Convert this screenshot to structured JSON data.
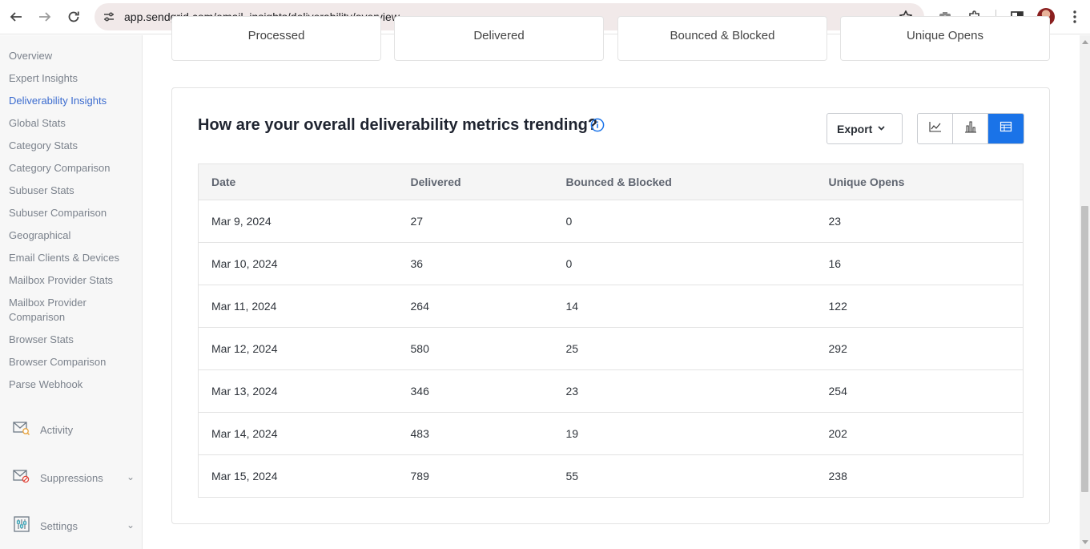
{
  "browser": {
    "url": "app.sendgrid.com/email_insights/deliverability/overview"
  },
  "sidebar": {
    "links": [
      {
        "label": "Overview",
        "active": false
      },
      {
        "label": "Expert Insights",
        "active": false
      },
      {
        "label": "Deliverability Insights",
        "active": true
      },
      {
        "label": "Global Stats",
        "active": false
      },
      {
        "label": "Category Stats",
        "active": false
      },
      {
        "label": "Category Comparison",
        "active": false
      },
      {
        "label": "Subuser Stats",
        "active": false
      },
      {
        "label": "Subuser Comparison",
        "active": false
      },
      {
        "label": "Geographical",
        "active": false
      },
      {
        "label": "Email Clients & Devices",
        "active": false
      },
      {
        "label": "Mailbox Provider Stats",
        "active": false
      },
      {
        "label": "Mailbox Provider Comparison",
        "active": false
      },
      {
        "label": "Browser Stats",
        "active": false
      },
      {
        "label": "Browser Comparison",
        "active": false
      },
      {
        "label": "Parse Webhook",
        "active": false
      }
    ],
    "groups": [
      {
        "label": "Activity",
        "icon": "activity-icon"
      },
      {
        "label": "Suppressions",
        "icon": "suppressions-icon"
      },
      {
        "label": "Settings",
        "icon": "settings-icon"
      }
    ]
  },
  "stat_cards": [
    "Processed",
    "Delivered",
    "Bounced & Blocked",
    "Unique Opens"
  ],
  "card": {
    "title": "How are your overall deliverability metrics trending?",
    "export_label": "Export"
  },
  "table": {
    "columns": [
      "Date",
      "Delivered",
      "Bounced & Blocked",
      "Unique Opens"
    ],
    "rows": [
      [
        "Mar 9, 2024",
        "27",
        "0",
        "23"
      ],
      [
        "Mar 10, 2024",
        "36",
        "0",
        "16"
      ],
      [
        "Mar 11, 2024",
        "264",
        "14",
        "122"
      ],
      [
        "Mar 12, 2024",
        "580",
        "25",
        "292"
      ],
      [
        "Mar 13, 2024",
        "346",
        "23",
        "254"
      ],
      [
        "Mar 14, 2024",
        "483",
        "19",
        "202"
      ],
      [
        "Mar 15, 2024",
        "789",
        "55",
        "238"
      ]
    ]
  },
  "colors": {
    "accent": "#1a73e8",
    "active_link": "#3c6ccf"
  }
}
